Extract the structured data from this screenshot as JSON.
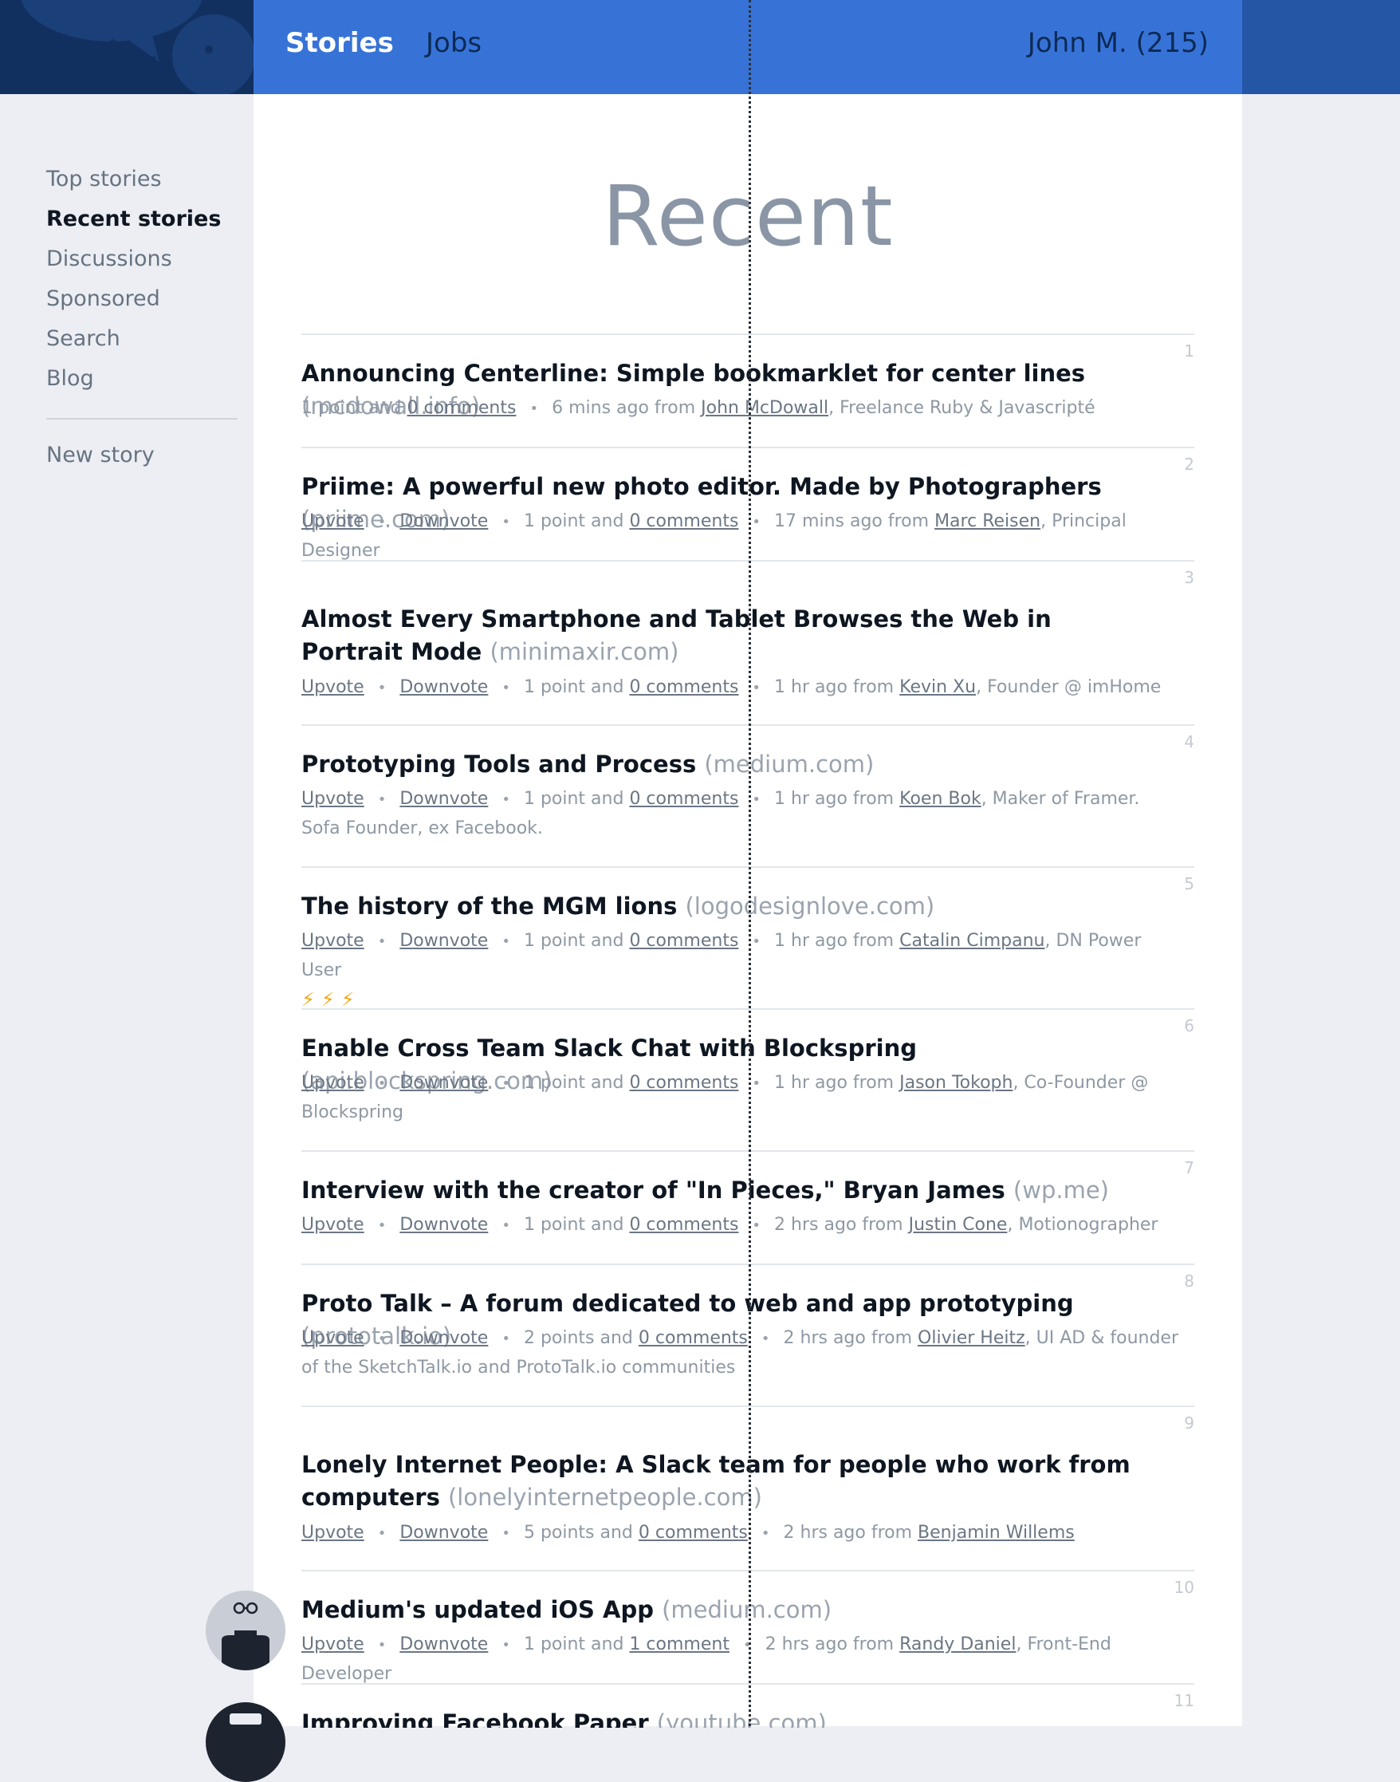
{
  "header": {
    "nav_stories": "Stories",
    "nav_jobs": "Jobs",
    "user": "John M. (215)"
  },
  "sidebar": {
    "items": [
      "Top stories",
      "Recent stories",
      "Discussions",
      "Sponsored",
      "Search",
      "Blog"
    ],
    "new_story": "New story"
  },
  "page": {
    "title": "Recent"
  },
  "labels": {
    "upvote": "Upvote",
    "downvote": "Downvote"
  },
  "stories": [
    {
      "rank": "1",
      "title": "Announcing Centerline: Simple bookmarklet for center lines",
      "domain": "(mcdowall.info)",
      "points": "1 point and",
      "comments": "0 comments",
      "time": "6 mins ago from",
      "author": "John McDowall",
      "role": ", Freelance Ruby & Javascripté"
    },
    {
      "rank": "2",
      "title": "Priime: A powerful new photo editor. Made by Photographers",
      "domain": "(priime.com)",
      "points": "1 point and",
      "comments": "0 comments",
      "time": "17 mins ago from",
      "author": "Marc Reisen",
      "role": ", Principal Designer"
    },
    {
      "rank": "3",
      "title": "Almost Every Smartphone and Tablet Browses the Web in Portrait Mode",
      "domain": "(minimaxir.com)",
      "points": "1 point and",
      "comments": "0 comments",
      "time": "1 hr ago from",
      "author": "Kevin Xu",
      "role": ", Founder @ imHome"
    },
    {
      "rank": "4",
      "title": "Prototyping Tools and Process",
      "domain": "(medium.com)",
      "points": "1 point and",
      "comments": "0 comments",
      "time": "1 hr ago from",
      "author": "Koen Bok",
      "role": ", Maker of Framer. Sofa Founder, ex Facebook."
    },
    {
      "rank": "5",
      "title": "The history of the MGM lions",
      "domain": "(logodesignlove.com)",
      "points": "1 point and",
      "comments": "0 comments",
      "time": "1 hr ago from",
      "author": "Catalin Cimpanu",
      "role": ", DN Power User",
      "bolts": "⚡⚡⚡"
    },
    {
      "rank": "6",
      "title": "Enable Cross Team Slack Chat with Blockspring",
      "domain": "(api.blockspring.com)",
      "points": "1 point and",
      "comments": "0 comments",
      "time": "1 hr ago from",
      "author": "Jason Tokoph",
      "role": ", Co-Founder @ Blockspring"
    },
    {
      "rank": "7",
      "title": "Interview with the creator of \"In Pieces,\" Bryan James",
      "domain": "(wp.me)",
      "points": "1 point and",
      "comments": "0 comments",
      "time": "2 hrs ago from",
      "author": "Justin Cone",
      "role": ", Motionographer"
    },
    {
      "rank": "8",
      "title": "Proto Talk – A forum dedicated to web and app prototyping",
      "domain": "(prototalk.io)",
      "points": "2 points and",
      "comments": "0 comments",
      "time": "2 hrs ago from",
      "author": "Olivier Heitz",
      "role": ", UI AD & founder of the SketchTalk.io and ProtoTalk.io communities"
    },
    {
      "rank": "9",
      "title": "Lonely Internet People: A Slack team for people who work from computers",
      "domain": "(lonelyinternetpeople.com)",
      "points": "5 points and",
      "comments": "0 comments",
      "time": "2 hrs ago from",
      "author": "Benjamin Willems",
      "role": ""
    },
    {
      "rank": "10",
      "title": "Medium's updated iOS App",
      "domain": "(medium.com)",
      "points": "1 point and",
      "comments": "1 comment",
      "time": "2 hrs ago from",
      "author": "Randy Daniel",
      "role": ", Front-End Developer"
    },
    {
      "rank": "11",
      "title": "Improving Facebook Paper",
      "domain": "(youtube.com)",
      "points": "",
      "comments": "",
      "time": "",
      "author": "",
      "role": ""
    }
  ]
}
